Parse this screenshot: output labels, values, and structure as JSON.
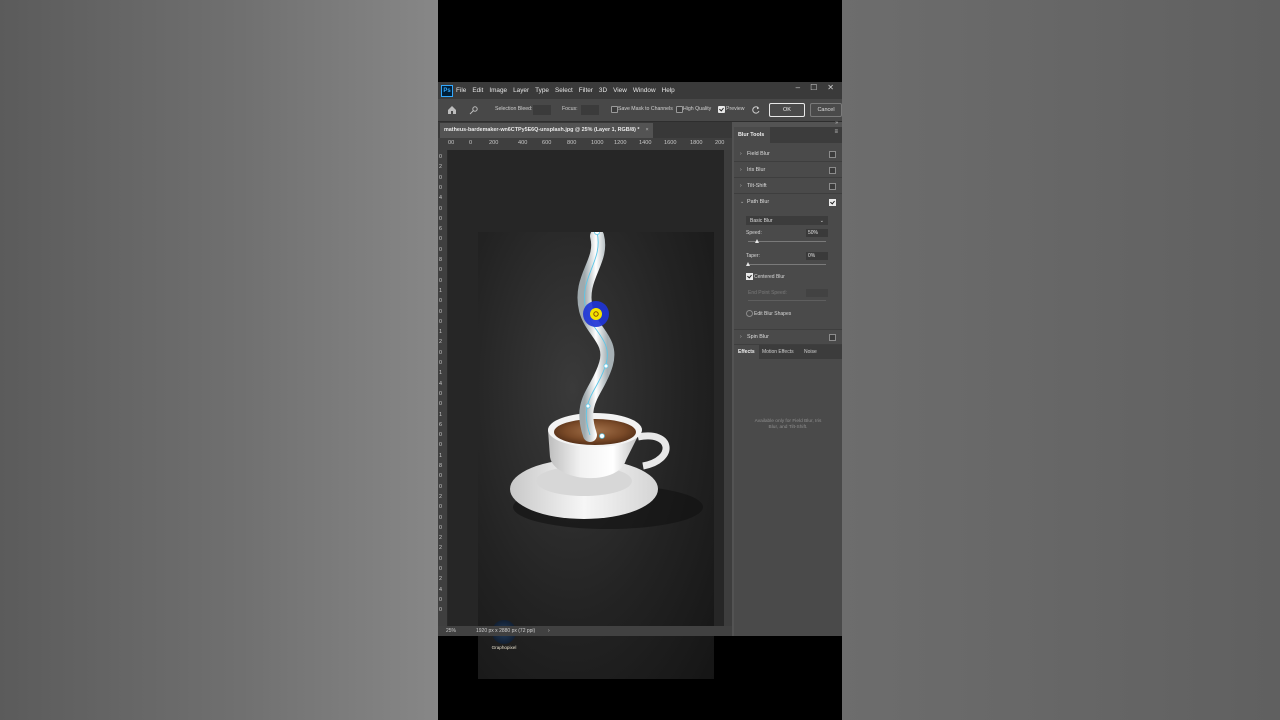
{
  "menubar": {
    "logo": "Ps",
    "items": [
      "File",
      "Edit",
      "Image",
      "Layer",
      "Type",
      "Select",
      "Filter",
      "3D",
      "View",
      "Window",
      "Help"
    ],
    "window_controls": [
      "–",
      "☐",
      "✕"
    ]
  },
  "options": {
    "selection_bleed_label": "Selection Bleed:",
    "focus_label": "Focus:",
    "save_mask_label": "Save Mask to Channels",
    "high_quality_label": "High Quality",
    "preview_label": "Preview",
    "ok_label": "OK",
    "cancel_label": "Cancel"
  },
  "document": {
    "tab_title": "matheus-bardemaker-wn6CTPy5E6Q-unsplash.jpg @ 25% (Layer 1, RGB/8) *",
    "close": "×",
    "ruler_top": [
      "00",
      "0",
      "200",
      "400",
      "600",
      "800",
      "1000",
      "1200",
      "1400",
      "1600",
      "1800",
      "200"
    ],
    "ruler_left": [
      "0",
      "2",
      "0",
      "0",
      "4",
      "0",
      "0",
      "6",
      "0",
      "0",
      "8",
      "0",
      "0",
      "1",
      "0",
      "0",
      "0",
      "1",
      "2",
      "0",
      "0",
      "1",
      "4",
      "0",
      "0",
      "1",
      "6",
      "0",
      "0",
      "1",
      "8",
      "0",
      "0",
      "2",
      "0",
      "0",
      "0",
      "2",
      "2",
      "0",
      "0",
      "2",
      "4",
      "0",
      "0"
    ],
    "zoom": "25%",
    "dimensions": "1920 px x 2880 px (72 ppi)",
    "status_arrow": "›",
    "watermark_text": "Graphopixel"
  },
  "panel": {
    "tab_label": "Blur Tools",
    "collapse": "»",
    "menu": "≡",
    "blur_types": [
      {
        "label": "Field Blur",
        "chevron": "›",
        "checked": false
      },
      {
        "label": "Iris Blur",
        "chevron": "›",
        "checked": false
      },
      {
        "label": "Tilt-Shift",
        "chevron": "›",
        "checked": false
      },
      {
        "label": "Path Blur",
        "chevron": "⌄",
        "checked": true
      },
      {
        "label": "Spin Blur",
        "chevron": "›",
        "checked": false
      }
    ],
    "path_blur": {
      "mode": "Basic Blur",
      "speed_label": "Speed:",
      "speed_value": "50%",
      "speed": 0.5,
      "taper_label": "Taper:",
      "taper_value": "0%",
      "taper": 0,
      "centered_blur_label": "Centered Blur",
      "end_point_speed_label": "End Point Speed:",
      "edit_blur_shapes_label": "Edit Blur Shapes"
    },
    "effects_tabs": [
      "Effects",
      "Motion Effects",
      "Noise"
    ],
    "effects_note": "Available only for Field Blur, Iris Blur, and Tilt-Shift."
  },
  "colors": {
    "accent": "#31a8ff",
    "pin_yellow": "#f4e400",
    "pin_blue": "#1f35d6",
    "path_line": "#5cc7e8"
  }
}
